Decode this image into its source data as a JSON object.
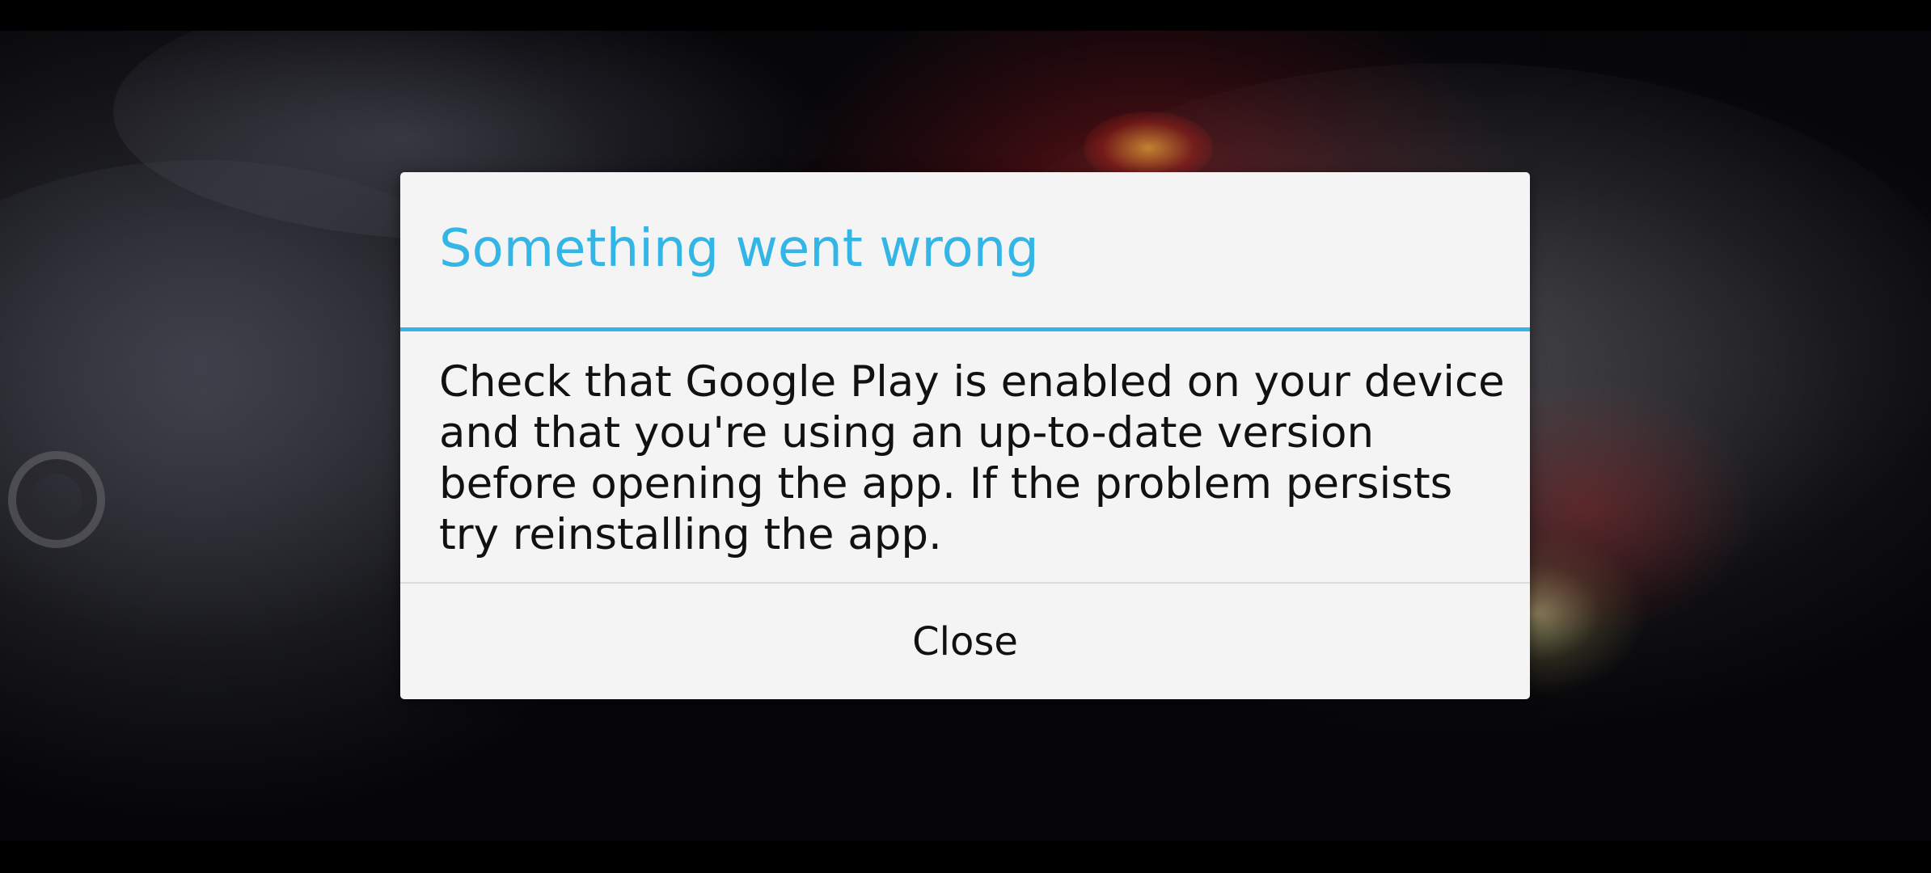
{
  "dialog": {
    "title": "Something went wrong",
    "message": "Check that Google Play is enabled on your device and that you're using an up-to-date version before opening the app. If the problem persists try reinstalling the app.",
    "close_label": "Close"
  },
  "colors": {
    "accent": "#33b5e5",
    "dialog_background": "#f4f4f4",
    "text": "#111111"
  }
}
